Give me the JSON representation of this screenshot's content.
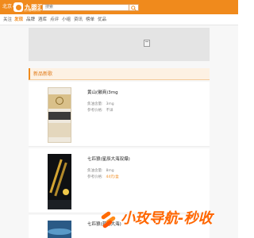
{
  "header": {
    "city": "北京",
    "logo_text": "九婴汇",
    "logo_subtitle": "世界烟草资讯网",
    "search_value": "搜索"
  },
  "nav": {
    "items": [
      {
        "label": "关注",
        "active": false
      },
      {
        "label": "发现",
        "active": true
      },
      {
        "label": "品牌",
        "active": false
      },
      {
        "label": "酒库",
        "active": false
      },
      {
        "label": "点评",
        "active": false
      },
      {
        "label": "小组",
        "active": false
      },
      {
        "label": "资讯",
        "active": false
      },
      {
        "label": "榜单",
        "active": false
      },
      {
        "label": "优品",
        "active": false
      }
    ]
  },
  "section": {
    "title": "新品新歌"
  },
  "products": [
    {
      "name": "黄山(徽商)3mg",
      "spec1_label": "焦油含量:",
      "spec1_value": "3mg",
      "spec2_label": "参考价格:",
      "spec2_value": "不详"
    },
    {
      "name": "七匹狼(星辰大海双爆)",
      "spec1_label": "焦油含量:",
      "spec1_value": "8mg",
      "spec2_label": "参考价格:",
      "spec2_value": "44元/盒"
    },
    {
      "name": "七匹狼(蓝色大海)"
    }
  ],
  "watermark": {
    "text": "小玫导航-秒收"
  },
  "colors": {
    "accent": "#f08a1c",
    "price": "#f08a1c"
  }
}
